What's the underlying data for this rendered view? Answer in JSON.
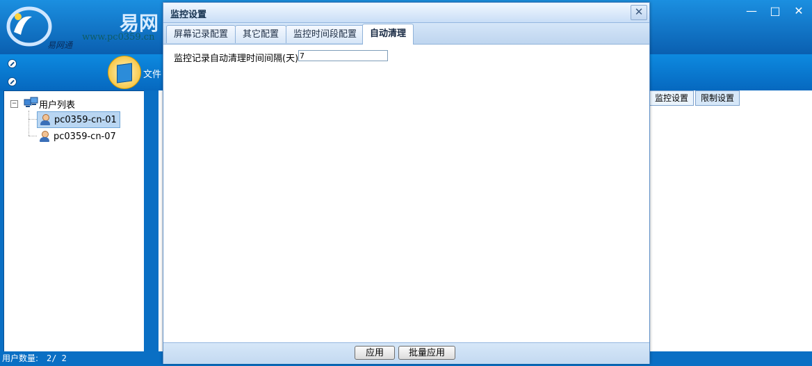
{
  "app": {
    "logo_text": "易网",
    "logo_sub": "易网通",
    "logo_url": "www.pc0359.cn",
    "window_controls": {
      "minimize": "—",
      "maximize": "□",
      "close": "✕"
    },
    "toolbar": {
      "file_label": "文件"
    }
  },
  "tree": {
    "toggle": "−",
    "root_label": "用户列表",
    "users": [
      {
        "name": "pc0359-cn-01",
        "selected": true
      },
      {
        "name": "pc0359-cn-07",
        "selected": false
      }
    ]
  },
  "main_tabs": [
    {
      "label": "监控设置",
      "active": true
    },
    {
      "label": "限制设置",
      "active": false
    }
  ],
  "status": {
    "label": "用户数量:",
    "value": "2/ 2"
  },
  "dialog": {
    "title": "监控设置",
    "close": "✕",
    "tabs": [
      {
        "label": "屏幕记录配置",
        "active": false
      },
      {
        "label": "其它配置",
        "active": false
      },
      {
        "label": "监控时间段配置",
        "active": false
      },
      {
        "label": "自动清理",
        "active": true
      }
    ],
    "field": {
      "label": "监控记录自动清理时间间隔(天):",
      "value": "7"
    },
    "buttons": {
      "apply": "应用",
      "batch_apply": "批量应用"
    }
  }
}
